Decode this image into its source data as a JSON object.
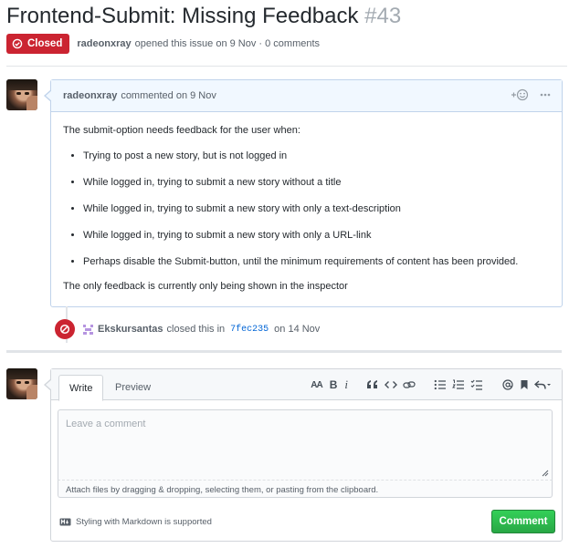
{
  "issue": {
    "title": "Frontend-Submit: Missing Feedback",
    "number": "#43",
    "state_label": "Closed",
    "author": "radeonxray",
    "meta_text": "opened this issue on 9 Nov · 0 comments"
  },
  "comment": {
    "author": "radeonxray",
    "date_text": "commented on 9 Nov",
    "intro": "The submit-option needs feedback for the user when:",
    "bullets": [
      "Trying to post a new story, but is not logged in",
      "While logged in, trying to submit a new story without a title",
      "While logged in, trying to submit a new story with only a text-description",
      "While logged in, trying to submit a new story with only a URL-link",
      "Perhaps disable the Submit-button, until the minimum requirements of content has been provided."
    ],
    "outro": "The only feedback is currently only being shown in the inspector",
    "reaction_icon": "smiley-plus-icon",
    "more_icon": "kebab-horizontal-icon"
  },
  "event": {
    "actor": "Ekskursantas",
    "action": "closed this in",
    "commit": "7fec235",
    "date": "on 14 Nov"
  },
  "editor": {
    "tab_write": "Write",
    "tab_preview": "Preview",
    "toolbar": {
      "header": "AA",
      "bold": "B",
      "italic": "i"
    },
    "placeholder": "Leave a comment",
    "attach_hint": "Attach files by dragging & dropping, selecting them, or pasting from the clipboard.",
    "markdown_hint": "Styling with Markdown is supported",
    "submit_label": "Comment"
  },
  "colors": {
    "closed": "#cb2431",
    "link": "#0366d6",
    "submit": "#2cbe4e",
    "comment_header": "#f1f8ff"
  }
}
